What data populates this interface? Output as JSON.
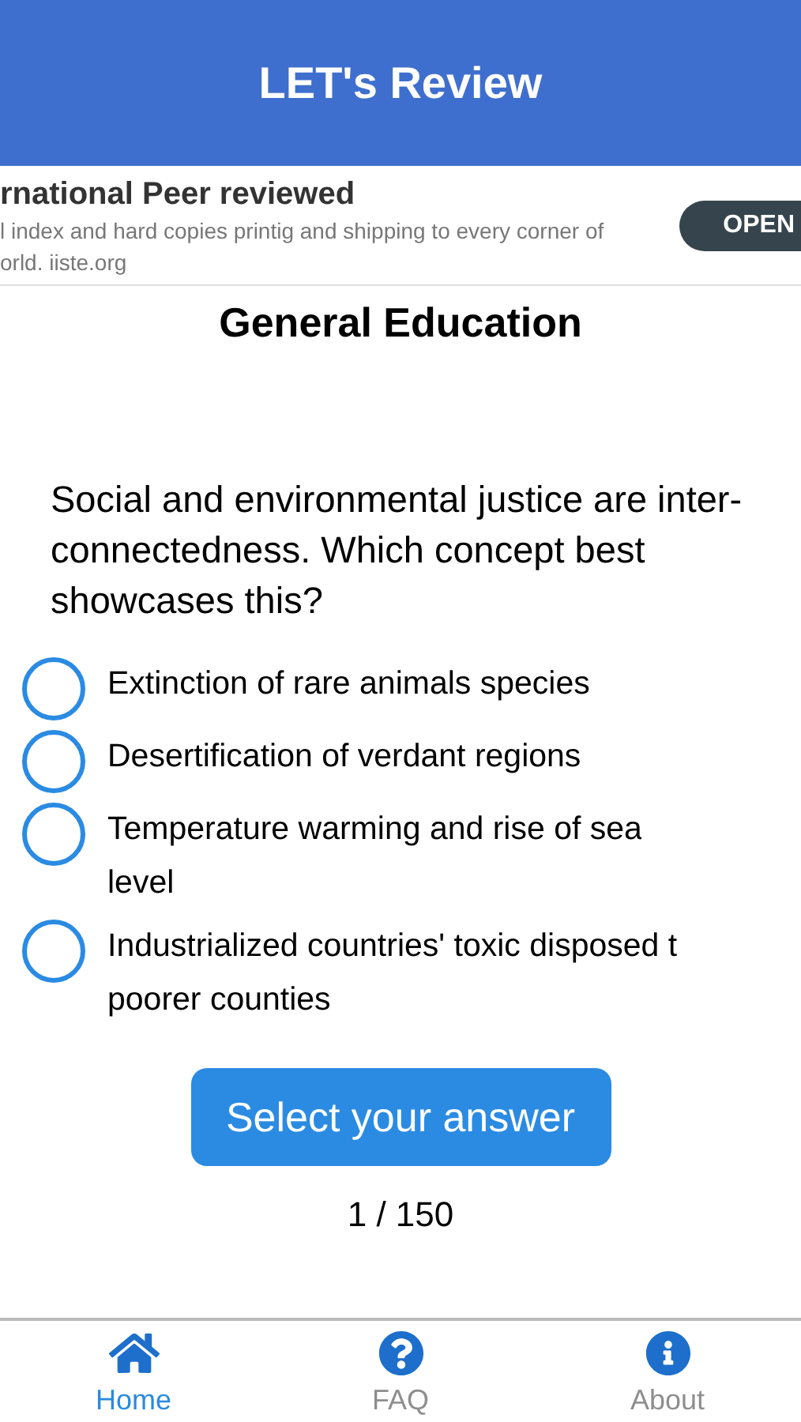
{
  "header": {
    "title": "LET's Review"
  },
  "ad": {
    "headline": "rnational Peer reviewed",
    "body_lines": [
      "l index and hard copies printig and shipping to every corner of",
      "orld. iiste.org"
    ],
    "button": "OPEN"
  },
  "subject": "General Education",
  "question": "Social and environmental justice are inter-connectedness. Which concept best showcases this?",
  "options": [
    {
      "lines": [
        "Extinction of rare animals species"
      ],
      "selected": false
    },
    {
      "lines": [
        "Desertification of verdant regions"
      ],
      "selected": false
    },
    {
      "lines": [
        "Temperature warming and rise of sea",
        "level"
      ],
      "selected": false
    },
    {
      "lines": [
        "Industrialized countries' toxic disposed t",
        "poorer counties"
      ],
      "selected": false
    }
  ],
  "submit_button": "Select your answer",
  "progress": "1 / 150",
  "tabs": [
    {
      "kind": "home",
      "label": "Home",
      "selected": true
    },
    {
      "kind": "faq",
      "label": "FAQ",
      "selected": false
    },
    {
      "kind": "about",
      "label": "About",
      "selected": false
    }
  ]
}
